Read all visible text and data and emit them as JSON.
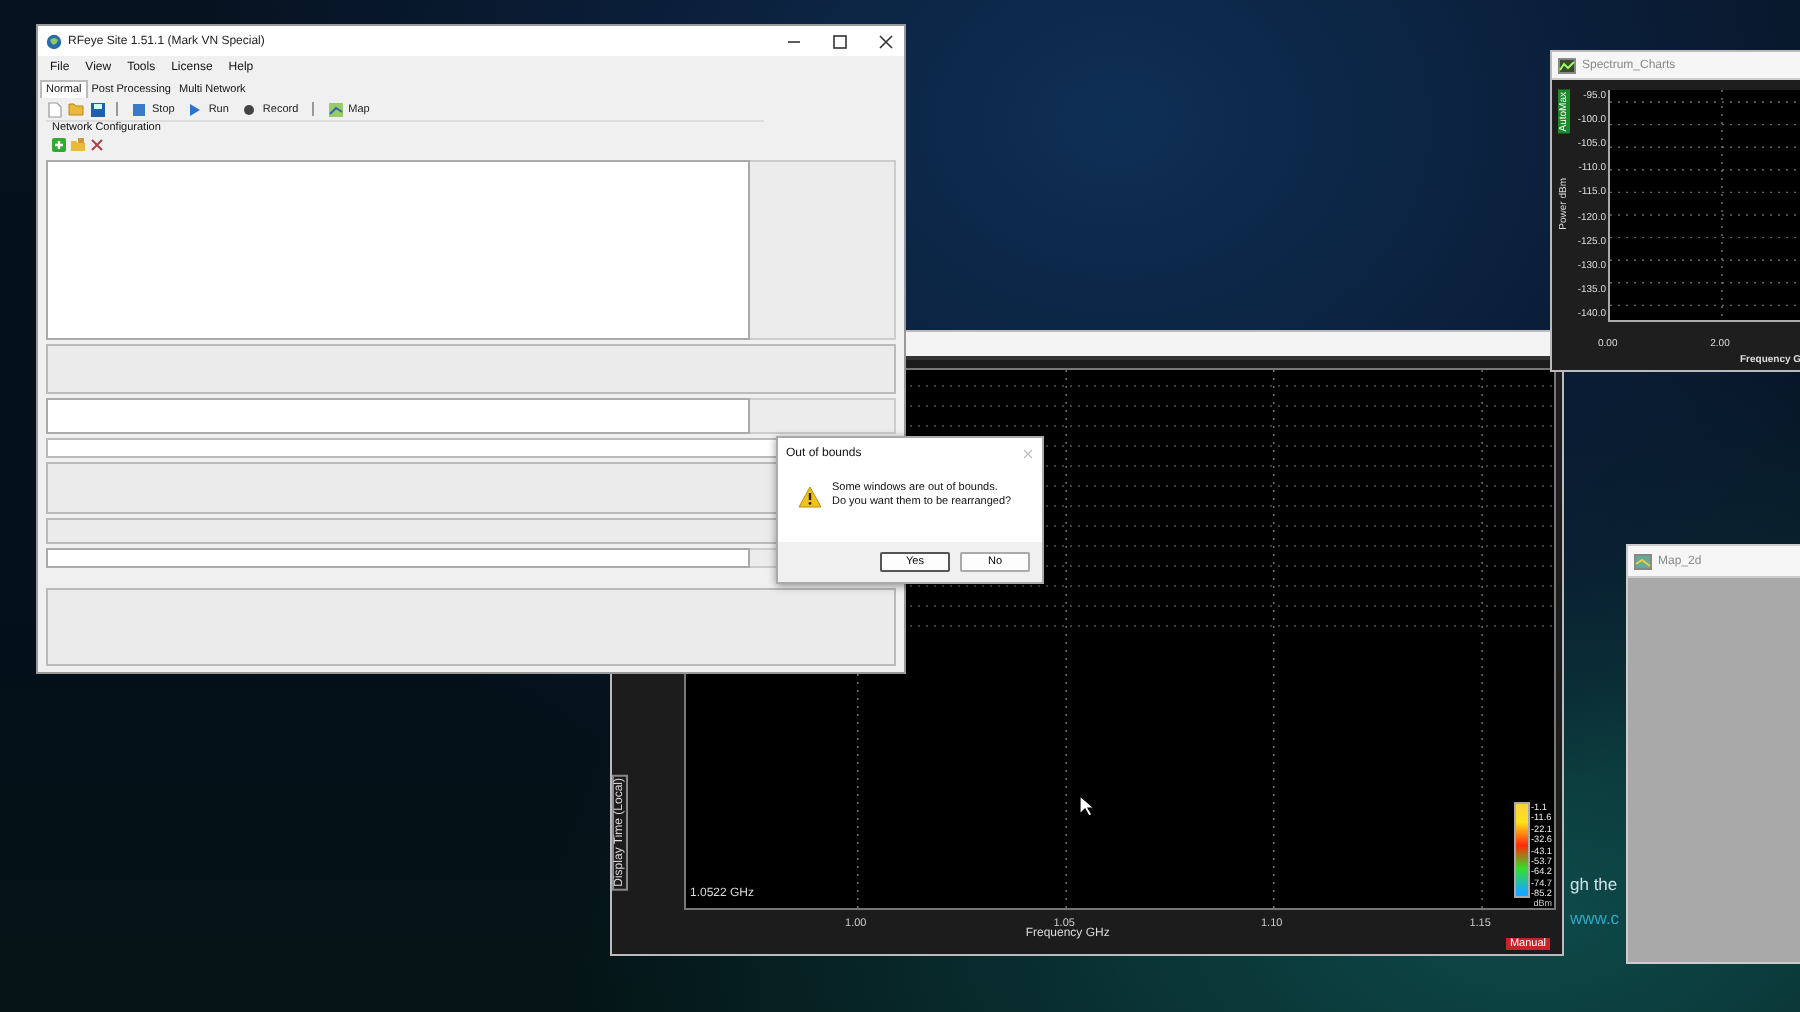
{
  "desktop": {
    "background_text": [
      "gh the",
      "www.c"
    ]
  },
  "waterfall_window": {
    "y_label": "Display Time (Local)",
    "frequency_readout": "1.0522 GHz",
    "x_ticks": [
      "1.00",
      "1.05",
      "1.10",
      "1.15"
    ],
    "x_label": "Frequency GHz",
    "color_scale": [
      "-1.1",
      "-11.6",
      "-22.1",
      "-32.6",
      "-43.1",
      "-53.7",
      "-64.2",
      "-74.7",
      "-85.2"
    ],
    "scale_unit": "dBm",
    "mode_badge": "Manual"
  },
  "spectrum_window": {
    "title": "Spectrum_Charts",
    "mode_badge": "AutoMax",
    "y_label": "Power dBm",
    "y_ticks": [
      "-95.0",
      "-100.0",
      "-105.0",
      "-110.0",
      "-115.0",
      "-120.0",
      "-125.0",
      "-130.0",
      "-135.0",
      "-140.0"
    ],
    "x_ticks": [
      "0.00",
      "2.00"
    ],
    "x_label": "Frequency G"
  },
  "map_window": {
    "title": "Map_2d"
  },
  "main_window": {
    "title": "RFeye Site 1.51.1 (Mark VN Special)",
    "menu": [
      "File",
      "View",
      "Tools",
      "License",
      "Help"
    ],
    "tabs": [
      {
        "label": "Normal",
        "selected": true
      },
      {
        "label": "Post Processing",
        "selected": false
      },
      {
        "label": "Multi Network",
        "selected": false
      }
    ],
    "toolbar": [
      "Stop",
      "Run",
      "Record",
      "Map"
    ],
    "group_title": "Network Configuration"
  },
  "dialog": {
    "title": "Out of bounds",
    "message": [
      "Some windows are out of bounds.",
      "Do you want them to be rearranged?"
    ],
    "buttons": [
      {
        "label": "Yes",
        "selected": true
      },
      {
        "label": "No",
        "selected": false
      }
    ]
  }
}
